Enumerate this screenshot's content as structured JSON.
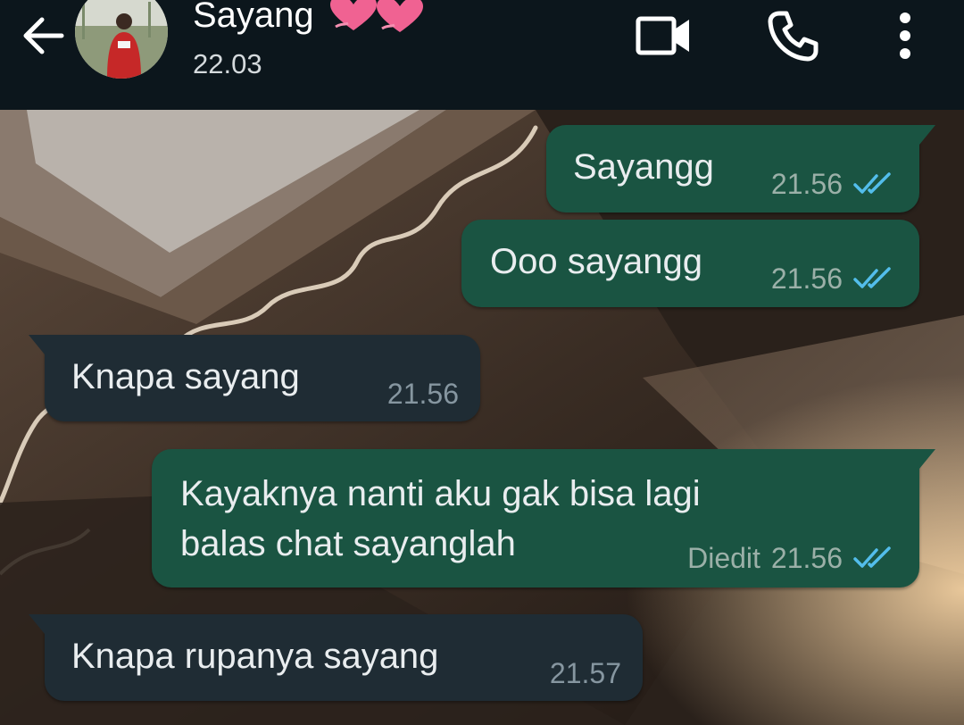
{
  "header": {
    "contact_name": "Sayang",
    "last_seen": "22.03",
    "icons": {
      "back": "arrow-left-icon",
      "video": "video-call-icon",
      "call": "phone-icon",
      "menu": "more-vert-icon",
      "hearts": "pink-hearts-emoji"
    }
  },
  "messages": [
    {
      "direction": "outgoing",
      "text": "Sayangg",
      "time": "21.56",
      "status": "read"
    },
    {
      "direction": "outgoing",
      "text": "Ooo sayangg",
      "time": "21.56",
      "status": "read"
    },
    {
      "direction": "incoming",
      "text": "Knapa sayang",
      "time": "21.56"
    },
    {
      "direction": "outgoing",
      "text": "Kayaknya nanti aku gak bisa lagi\nbalas chat sayanglah",
      "edited_label": "Diedit",
      "time": "21.56",
      "status": "read"
    },
    {
      "direction": "incoming",
      "text": "Knapa rupanya sayang",
      "time": "21.57"
    }
  ],
  "colors": {
    "header_bg": "#0c161c",
    "outgoing_bubble": "#1a5442",
    "incoming_bubble": "#1f2c34",
    "read_ticks": "#53bdeb",
    "heart_pink": "#f06292"
  }
}
